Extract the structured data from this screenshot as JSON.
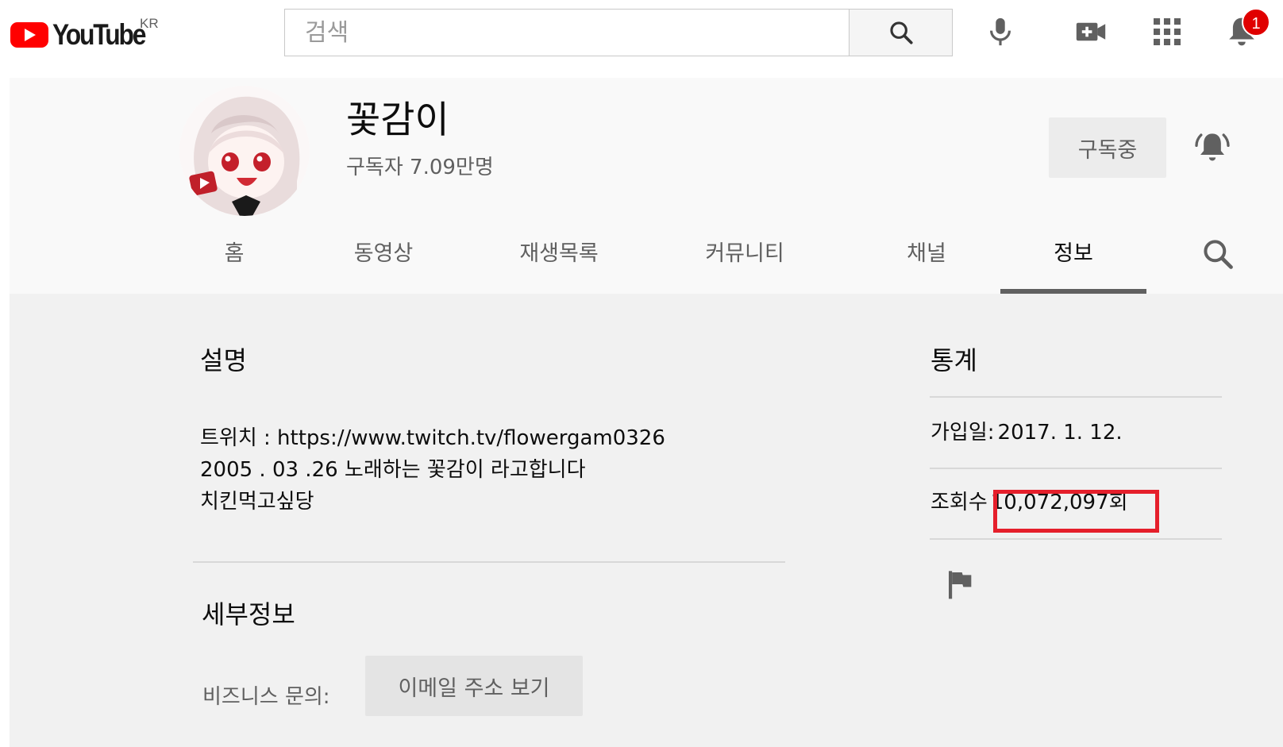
{
  "masthead": {
    "logo_text": "YouTube",
    "region": "KR",
    "search_placeholder": "검색",
    "icons": [
      "search-icon",
      "microphone-icon",
      "create-video-icon",
      "apps-grid-icon",
      "notifications-bell-icon"
    ],
    "notification_count": "1",
    "brand_red": "#ff0000"
  },
  "channel": {
    "name": "꽃감이",
    "subscribers": "구독자 7.09만명",
    "subscribe_label": "구독중",
    "tabs": [
      {
        "label": "홈",
        "active": false
      },
      {
        "label": "동영상",
        "active": false
      },
      {
        "label": "재생목록",
        "active": false
      },
      {
        "label": "커뮤니티",
        "active": false
      },
      {
        "label": "채널",
        "active": false
      },
      {
        "label": "정보",
        "active": true
      }
    ]
  },
  "about": {
    "description_title": "설명",
    "description": "트위치 : https://www.twitch.tv/flowergam0326\n2005 . 03 .26 노래하는 꽃감이 라고합니다\n치킨먹고싶당",
    "details_title": "세부정보",
    "business_label": "비즈니스 문의:",
    "email_button": "이메일 주소 보기",
    "stats_title": "통계",
    "joined_label": "가입일:",
    "joined_value": "2017. 1. 12.",
    "views_label": "조회수",
    "views_value": "10,072,097회",
    "highlight_color": "#e51f2b"
  }
}
